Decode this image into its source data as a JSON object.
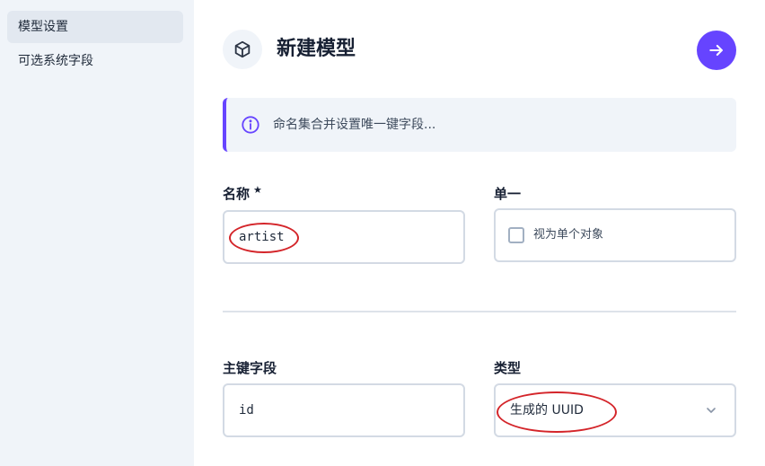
{
  "sidebar": {
    "items": [
      {
        "label": "模型设置",
        "active": true
      },
      {
        "label": "可选系统字段",
        "active": false
      }
    ]
  },
  "header": {
    "title": "新建模型",
    "icon": "cube-icon",
    "next_icon": "arrow-right-icon"
  },
  "notice": {
    "icon": "info-icon",
    "text": "命名集合并设置唯一键字段..."
  },
  "form": {
    "name": {
      "label": "名称",
      "required_mark": "★",
      "value": "artist"
    },
    "singleton": {
      "label": "单一",
      "checkbox_label": "视为单个对象",
      "checked": false
    },
    "primary_key": {
      "label": "主键字段",
      "value": "id"
    },
    "type": {
      "label": "类型",
      "value": "生成的 UUID"
    }
  },
  "colors": {
    "accent": "#6644ff",
    "annotation": "#d4252a",
    "sidebar_bg": "#f0f4f9"
  }
}
